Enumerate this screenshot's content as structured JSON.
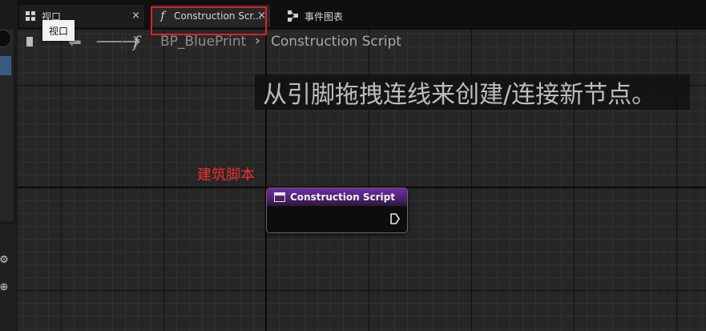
{
  "tabs": {
    "viewport": {
      "label": "视口",
      "icon": "viewport-grid-icon",
      "close": "×"
    },
    "construction": {
      "label": "Construction Scr...",
      "icon": "function-icon",
      "close": "×"
    },
    "event_graph": {
      "label": "事件图表",
      "icon": "event-graph-icon"
    }
  },
  "tooltip": {
    "text": "视口"
  },
  "nav": {
    "back": "⬅",
    "forward": "🡒",
    "function_glyph": "f",
    "breadcrumb": [
      "BP_BluePrint",
      "Construction Script"
    ],
    "chevron": "›"
  },
  "canvas": {
    "hint": "从引脚拖拽连线来创建/连接新节点。"
  },
  "annotation": {
    "text": "建筑脚本",
    "color": "#ea3030"
  },
  "node": {
    "title": "Construction Script",
    "header_color": "#6e2da0"
  },
  "left_icons": {
    "settings": "⚙",
    "add": "⊕"
  },
  "highlight": {
    "color": "#e02020",
    "target": "construction-script-tab"
  }
}
